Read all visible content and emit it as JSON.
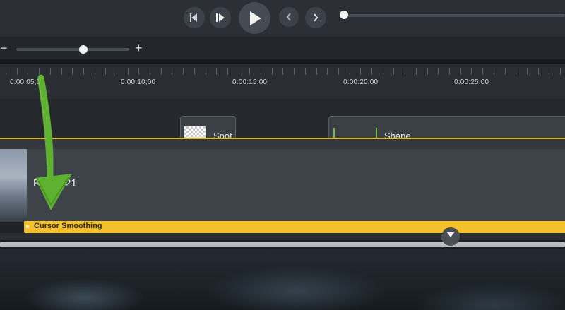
{
  "transport": {
    "buttons": [
      "step-back",
      "step-forward",
      "play",
      "previous",
      "next"
    ]
  },
  "zoom": {
    "minus_label": "−",
    "plus_label": "+"
  },
  "ruler": {
    "labels": [
      "0:00:05;00",
      "0:00:10;00",
      "0:00:15;00",
      "0:00:20;00",
      "0:00:25;00"
    ]
  },
  "tracks": {
    "spot_clip_label": "Spot",
    "shape_clip_label": "Shape",
    "main_clip_label": "R 3-2021",
    "cursor_effect_label": "Cursor Smoothing"
  },
  "colors": {
    "effect_bar": "#f4c02b",
    "annotation_arrow": "#5fb230",
    "track_line": "#d9b22b"
  },
  "icons": [
    "step-back-icon",
    "step-forward-icon",
    "play-icon",
    "chevron-left-icon",
    "chevron-right-icon",
    "playhead-icon",
    "annotation-arrow-icon"
  ]
}
